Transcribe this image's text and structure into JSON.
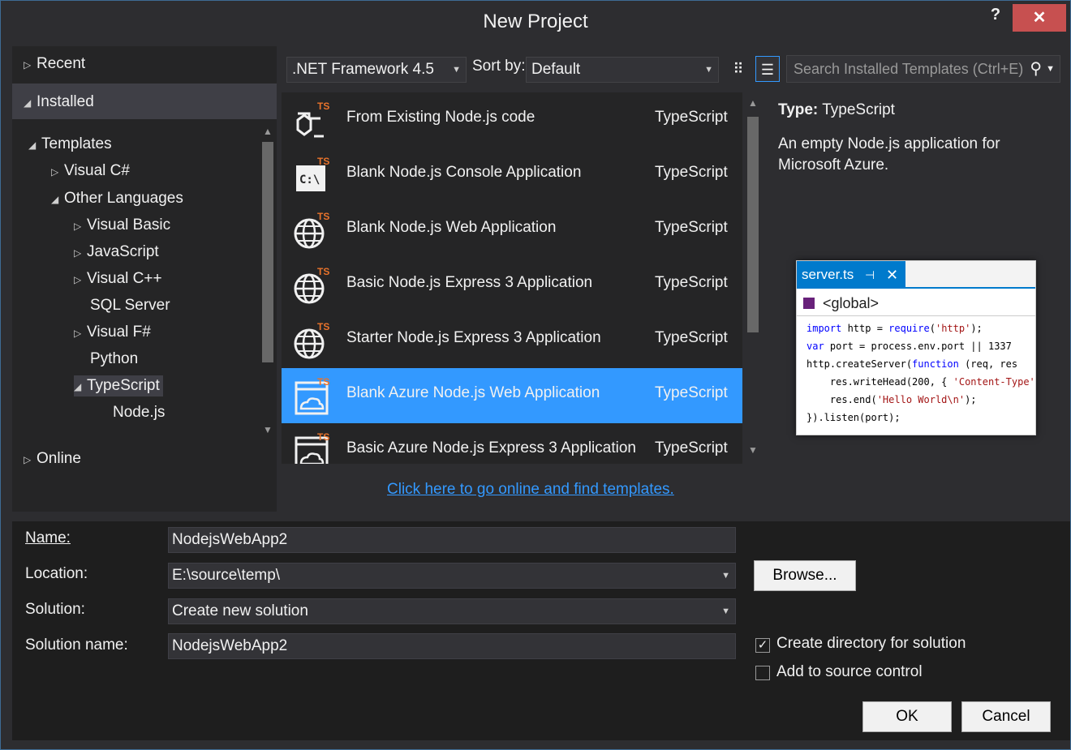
{
  "window": {
    "title": "New Project",
    "help_label": "?",
    "close_label": "✕"
  },
  "tree": {
    "recent": "Recent",
    "installed": "Installed",
    "templates": "Templates",
    "visual_csharp": "Visual C#",
    "other_languages": "Other Languages",
    "visual_basic": "Visual Basic",
    "javascript": "JavaScript",
    "visual_cpp": "Visual C++",
    "sql_server": "SQL Server",
    "visual_fsharp": "Visual F#",
    "python": "Python",
    "typescript": "TypeScript",
    "nodejs": "Node.js",
    "online": "Online"
  },
  "toolbar": {
    "framework": ".NET Framework 4.5",
    "sort_label": "Sort by:",
    "sort_value": "Default",
    "search_placeholder": "Search Installed Templates (Ctrl+E)"
  },
  "templates": [
    {
      "name": "From Existing Node.js code",
      "lang": "TypeScript",
      "icon": "folder-ts-icon"
    },
    {
      "name": "Blank Node.js Console Application",
      "lang": "TypeScript",
      "icon": "console-ts-icon"
    },
    {
      "name": "Blank Node.js Web Application",
      "lang": "TypeScript",
      "icon": "globe-ts-icon"
    },
    {
      "name": "Basic Node.js Express 3 Application",
      "lang": "TypeScript",
      "icon": "globe-ts-icon"
    },
    {
      "name": "Starter Node.js Express 3 Application",
      "lang": "TypeScript",
      "icon": "globe-ts-icon"
    },
    {
      "name": "Blank Azure Node.js Web Application",
      "lang": "TypeScript",
      "icon": "azure-ts-icon",
      "selected": true
    },
    {
      "name": "Basic Azure Node.js Express 3 Application",
      "lang": "TypeScript",
      "icon": "azure-ts-icon"
    }
  ],
  "online_link": "Click here to go online and find templates.",
  "details": {
    "type_label": "Type:",
    "type_value": "TypeScript",
    "description": "An empty Node.js application for Microsoft Azure."
  },
  "preview": {
    "tab": "server.ts",
    "pin": "⊣",
    "close": "✕",
    "nav": "<global>",
    "code": [
      {
        "parts": [
          [
            "kw",
            "import"
          ],
          [
            "t",
            " http = "
          ],
          [
            "kw",
            "require"
          ],
          [
            "t",
            "("
          ],
          [
            "str",
            "'http'"
          ],
          [
            "t",
            ");"
          ]
        ]
      },
      {
        "parts": [
          [
            "kw",
            "var"
          ],
          [
            "t",
            " port = process.env.port || 1337"
          ]
        ]
      },
      {
        "parts": [
          [
            "t",
            "http.createServer("
          ],
          [
            "kw",
            "function"
          ],
          [
            "t",
            " (req, res"
          ]
        ]
      },
      {
        "parts": [
          [
            "t",
            "    res.writeHead(200, { "
          ],
          [
            "str",
            "'Content-Type'"
          ]
        ]
      },
      {
        "parts": [
          [
            "t",
            "    res.end("
          ],
          [
            "str",
            "'Hello World\\n'"
          ],
          [
            "t",
            ");"
          ]
        ]
      },
      {
        "parts": [
          [
            "t",
            "}).listen(port);"
          ]
        ]
      }
    ]
  },
  "form": {
    "name_label": "Name:",
    "name_value": "NodejsWebApp2",
    "location_label": "Location:",
    "location_value": "E:\\source\\temp\\",
    "solution_label": "Solution:",
    "solution_value": "Create new solution",
    "solution_name_label": "Solution name:",
    "solution_name_value": "NodejsWebApp2",
    "browse_label": "Browse...",
    "create_dir_label": "Create directory for solution",
    "create_dir_checked": true,
    "source_control_label": "Add to source control",
    "source_control_checked": false,
    "ok_label": "OK",
    "cancel_label": "Cancel"
  },
  "colors": {
    "accent": "#3399ff",
    "close": "#c75050",
    "ts_orange": "#e9732b"
  }
}
